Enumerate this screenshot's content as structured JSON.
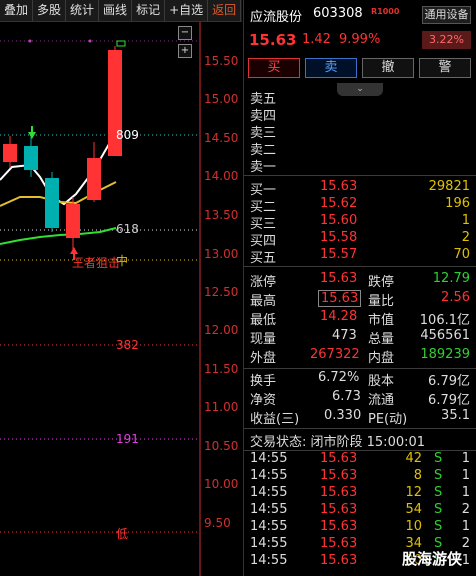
{
  "toolbar": {
    "items": [
      "叠加",
      "多股",
      "统计",
      "画线",
      "标记",
      "+自选",
      "返回"
    ]
  },
  "chart": {
    "price_ticks": [
      "15.50",
      "15.00",
      "14.50",
      "14.00",
      "13.50",
      "13.00",
      "12.50",
      "12.00",
      "11.50",
      "11.00",
      "10.50",
      "10.00",
      "9.50"
    ],
    "ma_labels": {
      "upper": "809",
      "middle": "618",
      "mid_label": "中",
      "l382": "382",
      "l191": "191",
      "low": "低"
    },
    "signal_text": "王者狙击",
    "btn_minus": "−",
    "btn_plus": "+",
    "colors": {
      "up": "#ff3333",
      "down": "#00b0b0",
      "ma_white": "#ffffff",
      "ma_yellow": "#e0c030",
      "ma_green": "#30e030",
      "fib_yellow": "#e0c000",
      "fib_red": "#ff3333",
      "fib_magenta": "#e040e0"
    }
  },
  "header": {
    "name": "应流股份",
    "code": "603308",
    "badge": "R1000",
    "settings": "通用设备",
    "price": "15.63",
    "change": "1.42",
    "change_pct": "9.99%",
    "sector_pct": "3.22%"
  },
  "actions": {
    "buy": "买",
    "sell": "卖",
    "cancel": "撤",
    "alert": "警"
  },
  "orderbook": {
    "asks": [
      {
        "label": "卖五",
        "price": "",
        "vol": ""
      },
      {
        "label": "卖四",
        "price": "",
        "vol": ""
      },
      {
        "label": "卖三",
        "price": "",
        "vol": ""
      },
      {
        "label": "卖二",
        "price": "",
        "vol": ""
      },
      {
        "label": "卖一",
        "price": "",
        "vol": ""
      }
    ],
    "bids": [
      {
        "label": "买一",
        "price": "15.63",
        "vol": "29821"
      },
      {
        "label": "买二",
        "price": "15.62",
        "vol": "196"
      },
      {
        "label": "买三",
        "price": "15.60",
        "vol": "1"
      },
      {
        "label": "买四",
        "price": "15.58",
        "vol": "2"
      },
      {
        "label": "买五",
        "price": "15.57",
        "vol": "70"
      }
    ]
  },
  "stats": {
    "limit_up_l": "涨停",
    "limit_up_v": "15.63",
    "limit_down_l": "跌停",
    "limit_down_v": "12.79",
    "high_l": "最高",
    "high_v": "15.63",
    "vol_ratio_l": "量比",
    "vol_ratio_v": "2.56",
    "low_l": "最低",
    "low_v": "14.28",
    "mcap_l": "市值",
    "mcap_v": "106.1亿",
    "curvol_l": "现量",
    "curvol_v": "473",
    "totvol_l": "总量",
    "totvol_v": "456561",
    "outer_l": "外盘",
    "outer_v": "267322",
    "inner_l": "内盘",
    "inner_v": "189239",
    "turnover_l": "换手",
    "turnover_v": "6.72%",
    "equity_l": "股本",
    "equity_v": "6.79亿",
    "nav_l": "净资",
    "nav_v": "6.73",
    "float_l": "流通",
    "float_v": "6.79亿",
    "eps_l": "收益(三)",
    "eps_v": "0.330",
    "pe_l": "PE(动)",
    "pe_v": "35.1"
  },
  "trade_status": "交易状态: 闭市阶段 15:00:01",
  "trades": [
    {
      "time": "14:55",
      "price": "15.63",
      "vol": "42",
      "side": "S",
      "n": "1"
    },
    {
      "time": "14:55",
      "price": "15.63",
      "vol": "8",
      "side": "S",
      "n": "1"
    },
    {
      "time": "14:55",
      "price": "15.63",
      "vol": "12",
      "side": "S",
      "n": "1"
    },
    {
      "time": "14:55",
      "price": "15.63",
      "vol": "54",
      "side": "S",
      "n": "2"
    },
    {
      "time": "14:55",
      "price": "15.63",
      "vol": "10",
      "side": "S",
      "n": "1"
    },
    {
      "time": "14:55",
      "price": "15.63",
      "vol": "34",
      "side": "S",
      "n": "2"
    },
    {
      "time": "14:55",
      "price": "15.63",
      "vol": "20",
      "side": "S",
      "n": "1"
    }
  ],
  "watermark": "股海游侠"
}
